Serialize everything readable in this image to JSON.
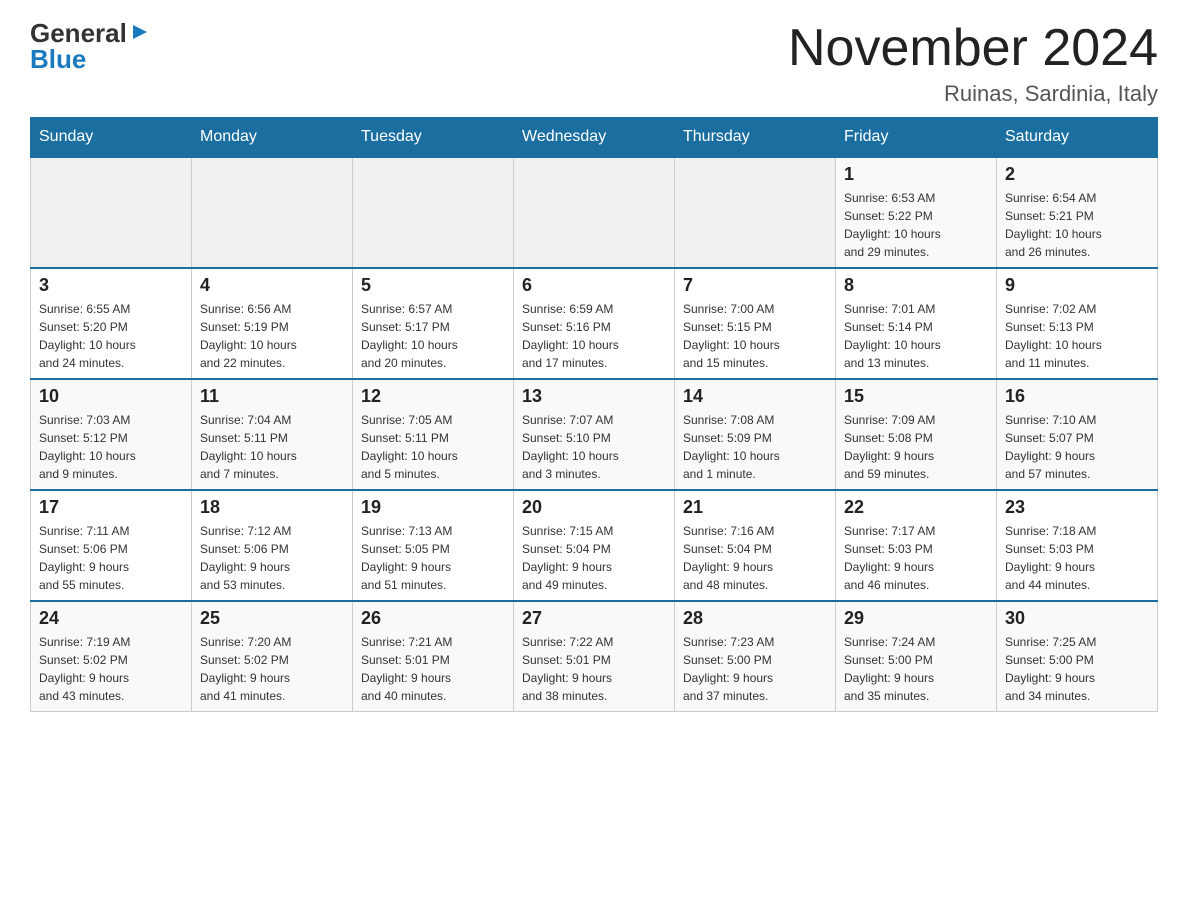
{
  "header": {
    "logo_general": "General",
    "logo_blue": "Blue",
    "title": "November 2024",
    "subtitle": "Ruinas, Sardinia, Italy"
  },
  "days_of_week": [
    "Sunday",
    "Monday",
    "Tuesday",
    "Wednesday",
    "Thursday",
    "Friday",
    "Saturday"
  ],
  "weeks": [
    [
      {
        "day": "",
        "info": ""
      },
      {
        "day": "",
        "info": ""
      },
      {
        "day": "",
        "info": ""
      },
      {
        "day": "",
        "info": ""
      },
      {
        "day": "",
        "info": ""
      },
      {
        "day": "1",
        "info": "Sunrise: 6:53 AM\nSunset: 5:22 PM\nDaylight: 10 hours\nand 29 minutes."
      },
      {
        "day": "2",
        "info": "Sunrise: 6:54 AM\nSunset: 5:21 PM\nDaylight: 10 hours\nand 26 minutes."
      }
    ],
    [
      {
        "day": "3",
        "info": "Sunrise: 6:55 AM\nSunset: 5:20 PM\nDaylight: 10 hours\nand 24 minutes."
      },
      {
        "day": "4",
        "info": "Sunrise: 6:56 AM\nSunset: 5:19 PM\nDaylight: 10 hours\nand 22 minutes."
      },
      {
        "day": "5",
        "info": "Sunrise: 6:57 AM\nSunset: 5:17 PM\nDaylight: 10 hours\nand 20 minutes."
      },
      {
        "day": "6",
        "info": "Sunrise: 6:59 AM\nSunset: 5:16 PM\nDaylight: 10 hours\nand 17 minutes."
      },
      {
        "day": "7",
        "info": "Sunrise: 7:00 AM\nSunset: 5:15 PM\nDaylight: 10 hours\nand 15 minutes."
      },
      {
        "day": "8",
        "info": "Sunrise: 7:01 AM\nSunset: 5:14 PM\nDaylight: 10 hours\nand 13 minutes."
      },
      {
        "day": "9",
        "info": "Sunrise: 7:02 AM\nSunset: 5:13 PM\nDaylight: 10 hours\nand 11 minutes."
      }
    ],
    [
      {
        "day": "10",
        "info": "Sunrise: 7:03 AM\nSunset: 5:12 PM\nDaylight: 10 hours\nand 9 minutes."
      },
      {
        "day": "11",
        "info": "Sunrise: 7:04 AM\nSunset: 5:11 PM\nDaylight: 10 hours\nand 7 minutes."
      },
      {
        "day": "12",
        "info": "Sunrise: 7:05 AM\nSunset: 5:11 PM\nDaylight: 10 hours\nand 5 minutes."
      },
      {
        "day": "13",
        "info": "Sunrise: 7:07 AM\nSunset: 5:10 PM\nDaylight: 10 hours\nand 3 minutes."
      },
      {
        "day": "14",
        "info": "Sunrise: 7:08 AM\nSunset: 5:09 PM\nDaylight: 10 hours\nand 1 minute."
      },
      {
        "day": "15",
        "info": "Sunrise: 7:09 AM\nSunset: 5:08 PM\nDaylight: 9 hours\nand 59 minutes."
      },
      {
        "day": "16",
        "info": "Sunrise: 7:10 AM\nSunset: 5:07 PM\nDaylight: 9 hours\nand 57 minutes."
      }
    ],
    [
      {
        "day": "17",
        "info": "Sunrise: 7:11 AM\nSunset: 5:06 PM\nDaylight: 9 hours\nand 55 minutes."
      },
      {
        "day": "18",
        "info": "Sunrise: 7:12 AM\nSunset: 5:06 PM\nDaylight: 9 hours\nand 53 minutes."
      },
      {
        "day": "19",
        "info": "Sunrise: 7:13 AM\nSunset: 5:05 PM\nDaylight: 9 hours\nand 51 minutes."
      },
      {
        "day": "20",
        "info": "Sunrise: 7:15 AM\nSunset: 5:04 PM\nDaylight: 9 hours\nand 49 minutes."
      },
      {
        "day": "21",
        "info": "Sunrise: 7:16 AM\nSunset: 5:04 PM\nDaylight: 9 hours\nand 48 minutes."
      },
      {
        "day": "22",
        "info": "Sunrise: 7:17 AM\nSunset: 5:03 PM\nDaylight: 9 hours\nand 46 minutes."
      },
      {
        "day": "23",
        "info": "Sunrise: 7:18 AM\nSunset: 5:03 PM\nDaylight: 9 hours\nand 44 minutes."
      }
    ],
    [
      {
        "day": "24",
        "info": "Sunrise: 7:19 AM\nSunset: 5:02 PM\nDaylight: 9 hours\nand 43 minutes."
      },
      {
        "day": "25",
        "info": "Sunrise: 7:20 AM\nSunset: 5:02 PM\nDaylight: 9 hours\nand 41 minutes."
      },
      {
        "day": "26",
        "info": "Sunrise: 7:21 AM\nSunset: 5:01 PM\nDaylight: 9 hours\nand 40 minutes."
      },
      {
        "day": "27",
        "info": "Sunrise: 7:22 AM\nSunset: 5:01 PM\nDaylight: 9 hours\nand 38 minutes."
      },
      {
        "day": "28",
        "info": "Sunrise: 7:23 AM\nSunset: 5:00 PM\nDaylight: 9 hours\nand 37 minutes."
      },
      {
        "day": "29",
        "info": "Sunrise: 7:24 AM\nSunset: 5:00 PM\nDaylight: 9 hours\nand 35 minutes."
      },
      {
        "day": "30",
        "info": "Sunrise: 7:25 AM\nSunset: 5:00 PM\nDaylight: 9 hours\nand 34 minutes."
      }
    ]
  ]
}
